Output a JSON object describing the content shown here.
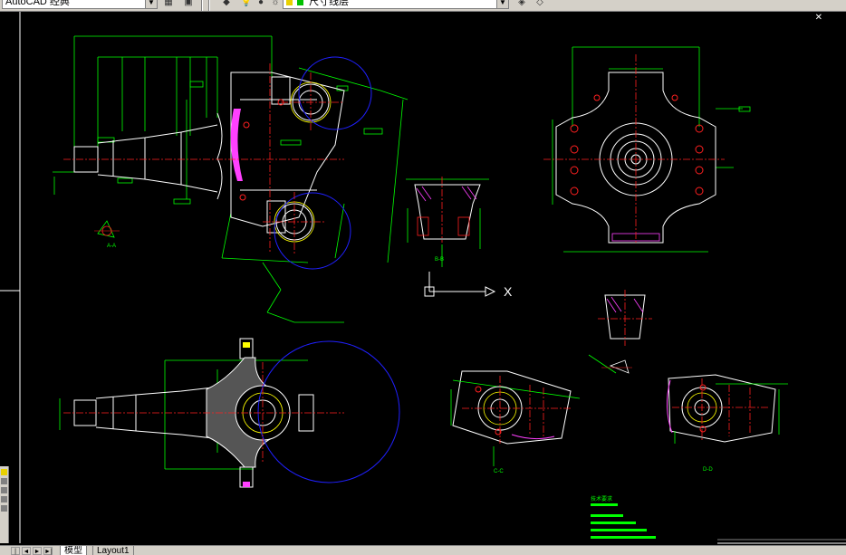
{
  "toolbar": {
    "workspace_value": "AutoCAD 经典",
    "layer_value": "尺寸线层"
  },
  "tabs": [
    {
      "label": "模型",
      "active": true
    },
    {
      "label": "Layout1",
      "active": false
    }
  ],
  "drawing": {
    "ucs_x_label": "X",
    "section_labels": [
      "A-A",
      "B-B",
      "C-C",
      "D-D"
    ],
    "notes_title": "技术要求"
  },
  "colors": {
    "background": "#000000",
    "dimension": "#00ff00",
    "outline": "#ffffff",
    "centerline": "#ff2020",
    "circle": "#2020ff",
    "hatch": "#ff40ff",
    "chrome": "#d4d0c8"
  }
}
